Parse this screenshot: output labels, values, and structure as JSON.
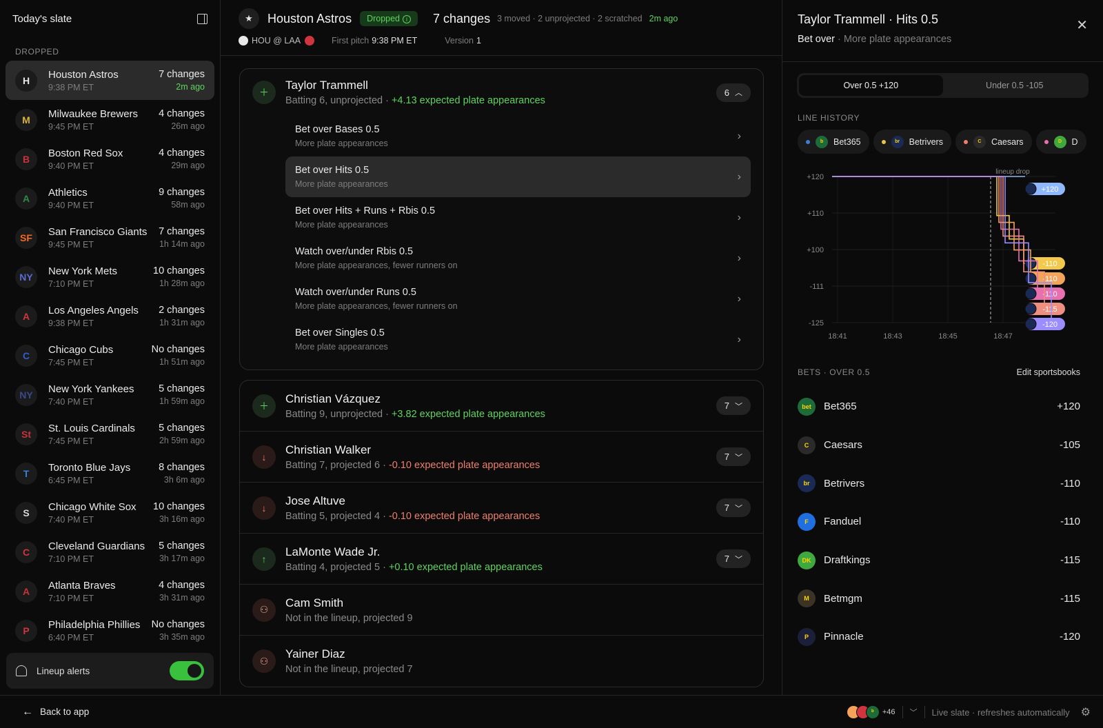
{
  "sidebar": {
    "title": "Today's slate",
    "section_label": "DROPPED",
    "teams": [
      {
        "name": "Houston Astros",
        "time": "9:38 PM ET",
        "changes": "7 changes",
        "ago": "2m ago",
        "logo": "H",
        "color": "#e8e8e8"
      },
      {
        "name": "Milwaukee Brewers",
        "time": "9:45 PM ET",
        "changes": "4 changes",
        "ago": "26m ago",
        "logo": "M",
        "color": "#d9b23a"
      },
      {
        "name": "Boston Red Sox",
        "time": "9:40 PM ET",
        "changes": "4 changes",
        "ago": "29m ago",
        "logo": "B",
        "color": "#c8323c"
      },
      {
        "name": "Athletics",
        "time": "9:40 PM ET",
        "changes": "9 changes",
        "ago": "58m ago",
        "logo": "A",
        "color": "#2f8a4a"
      },
      {
        "name": "San Francisco Giants",
        "time": "9:45 PM ET",
        "changes": "7 changes",
        "ago": "1h 14m ago",
        "logo": "SF",
        "color": "#f26b21"
      },
      {
        "name": "New York Mets",
        "time": "7:10 PM ET",
        "changes": "10 changes",
        "ago": "1h 28m ago",
        "logo": "NY",
        "color": "#5a6bd0"
      },
      {
        "name": "Los Angeles Angels",
        "time": "9:38 PM ET",
        "changes": "2 changes",
        "ago": "1h 31m ago",
        "logo": "A",
        "color": "#d0353f"
      },
      {
        "name": "Chicago Cubs",
        "time": "7:45 PM ET",
        "changes": "No changes",
        "ago": "1h 51m ago",
        "logo": "C",
        "color": "#2f5fd0"
      },
      {
        "name": "New York Yankees",
        "time": "7:40 PM ET",
        "changes": "5 changes",
        "ago": "1h 59m ago",
        "logo": "NY",
        "color": "#3a4a8a"
      },
      {
        "name": "St. Louis Cardinals",
        "time": "7:45 PM ET",
        "changes": "5 changes",
        "ago": "2h 59m ago",
        "logo": "St",
        "color": "#c8323c"
      },
      {
        "name": "Toronto Blue Jays",
        "time": "6:45 PM ET",
        "changes": "8 changes",
        "ago": "3h 6m ago",
        "logo": "T",
        "color": "#3a7fd5"
      },
      {
        "name": "Chicago White Sox",
        "time": "7:40 PM ET",
        "changes": "10 changes",
        "ago": "3h 16m ago",
        "logo": "S",
        "color": "#d8d8d8"
      },
      {
        "name": "Cleveland Guardians",
        "time": "7:10 PM ET",
        "changes": "5 changes",
        "ago": "3h 17m ago",
        "logo": "C",
        "color": "#d0353f"
      },
      {
        "name": "Atlanta Braves",
        "time": "7:10 PM ET",
        "changes": "4 changes",
        "ago": "3h 31m ago",
        "logo": "A",
        "color": "#c8323c"
      },
      {
        "name": "Philadelphia Phillies",
        "time": "6:40 PM ET",
        "changes": "No changes",
        "ago": "3h 35m ago",
        "logo": "P",
        "color": "#d0353f"
      }
    ],
    "alerts_label": "Lineup alerts"
  },
  "game": {
    "team": "Houston Astros",
    "status": "Dropped",
    "changes_title": "7 changes",
    "breakdown": "3 moved · 2 unprojected · 2 scratched",
    "ago": "2m ago",
    "matchup": "HOU @ LAA",
    "first_pitch_label": "First pitch",
    "first_pitch": "9:38 PM ET",
    "version_label": "Version",
    "version": "1"
  },
  "expanded_player": {
    "name": "Taylor Trammell",
    "status": "Batting 6, unprojected",
    "delta": "+4.13 expected plate appearances",
    "count": "6",
    "bets": [
      {
        "title": "Bet over Bases 0.5",
        "sub": "More plate appearances"
      },
      {
        "title": "Bet over Hits 0.5",
        "sub": "More plate appearances"
      },
      {
        "title": "Bet over Hits + Runs + Rbis 0.5",
        "sub": "More plate appearances"
      },
      {
        "title": "Watch over/under Rbis 0.5",
        "sub": "More plate appearances, fewer runners on"
      },
      {
        "title": "Watch over/under Runs 0.5",
        "sub": "More plate appearances, fewer runners on"
      },
      {
        "title": "Bet over Singles 0.5",
        "sub": "More plate appearances"
      }
    ]
  },
  "players": [
    {
      "name": "Christian Vázquez",
      "status": "Batting 9, unprojected",
      "delta": "+3.82 expected plate appearances",
      "count": "7",
      "kind": "add"
    },
    {
      "name": "Christian Walker",
      "status": "Batting 7, projected 6",
      "delta": "-0.10 expected plate appearances",
      "count": "7",
      "kind": "down"
    },
    {
      "name": "Jose Altuve",
      "status": "Batting 5, projected 4",
      "delta": "-0.10 expected plate appearances",
      "count": "7",
      "kind": "down"
    },
    {
      "name": "LaMonte Wade Jr.",
      "status": "Batting 4, projected 5",
      "delta": "+0.10 expected plate appearances",
      "count": "7",
      "kind": "up"
    },
    {
      "name": "Cam Smith",
      "status": "Not in the lineup, projected 9",
      "delta": "",
      "count": "",
      "kind": "out"
    },
    {
      "name": "Yainer Diaz",
      "status": "Not in the lineup, projected 7",
      "delta": "",
      "count": "",
      "kind": "out"
    }
  ],
  "detail": {
    "title": "Taylor Trammell · Hits 0.5",
    "action": "Bet over",
    "reason": "More plate appearances",
    "over_tab": "Over 0.5 +120",
    "under_tab": "Under 0.5 -105",
    "line_history_label": "LINE HISTORY",
    "chips": [
      {
        "name": "Bet365",
        "dot": "#3a7fd5",
        "logo_bg": "#1e6b3a",
        "logo_text": "b"
      },
      {
        "name": "Betrivers",
        "dot": "#e8c44a",
        "logo_bg": "#1a2a55",
        "logo_text": "br"
      },
      {
        "name": "Caesars",
        "dot": "#ee7f6c",
        "logo_bg": "#2a2a2a",
        "logo_text": "C"
      },
      {
        "name": "D",
        "dot": "#e86fb0",
        "logo_bg": "#3fa83f",
        "logo_text": "D"
      }
    ],
    "bets_label": "BETS · OVER 0.5",
    "edit_label": "Edit sportsbooks",
    "books": [
      {
        "name": "Bet365",
        "odds": "+120",
        "bg": "#1e6b3a",
        "txt": "bet"
      },
      {
        "name": "Caesars",
        "odds": "-105",
        "bg": "#2a2a2a",
        "txt": "C"
      },
      {
        "name": "Betrivers",
        "odds": "-110",
        "bg": "#1a2a55",
        "txt": "br"
      },
      {
        "name": "Fanduel",
        "odds": "-110",
        "bg": "#1f6fe0",
        "txt": "F"
      },
      {
        "name": "Draftkings",
        "odds": "-115",
        "bg": "#3fa83f",
        "txt": "DK"
      },
      {
        "name": "Betmgm",
        "odds": "-115",
        "bg": "#3a3326",
        "txt": "M"
      },
      {
        "name": "Pinnacle",
        "odds": "-120",
        "bg": "#1b1f3a",
        "txt": "P"
      }
    ]
  },
  "chart_data": {
    "type": "line",
    "yticks": [
      "+120",
      "+110",
      "+100",
      "-111",
      "-125"
    ],
    "xticks": [
      "18:41",
      "18:43",
      "18:45",
      "18:47"
    ],
    "annotation": "lineup drop",
    "series": [
      {
        "color": "#8fb8ff",
        "end_label": "+120"
      },
      {
        "color": "#f2c94c",
        "end_label": "-110"
      },
      {
        "color": "#f3a35a",
        "end_label": "-110"
      },
      {
        "color": "#e86fb0",
        "end_label": "-110"
      },
      {
        "color": "#ee8f7f",
        "end_label": "-115"
      },
      {
        "color": "#9b8cff",
        "end_label": "-120"
      }
    ]
  },
  "footer": {
    "back_label": "Back to app",
    "more_books": "+46",
    "live_status": "Live slate · refreshes automatically"
  }
}
